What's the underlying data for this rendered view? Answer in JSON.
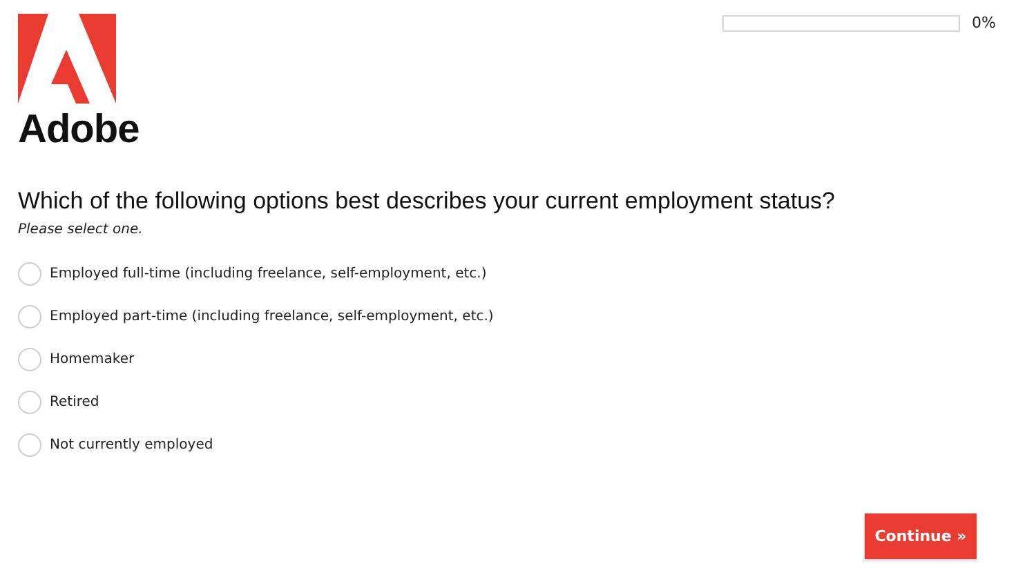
{
  "logo": {
    "wordmark": "Adobe"
  },
  "progress": {
    "level": 0,
    "reading": "0%"
  },
  "question": {
    "title": "Which of the following options best describes your current employment status?",
    "hint": "Please select one."
  },
  "options": [
    {
      "label": "Employed full-time (including freelance, self-employment, etc.)",
      "selected": false
    },
    {
      "label": "Employed part-time (including freelance, self-employment, etc.)",
      "selected": false
    },
    {
      "label": "Homemaker",
      "selected": false
    },
    {
      "label": "Retired",
      "selected": false
    },
    {
      "label": "Not currently employed",
      "selected": false
    }
  ],
  "buttons": {
    "continue": "Continue »"
  }
}
